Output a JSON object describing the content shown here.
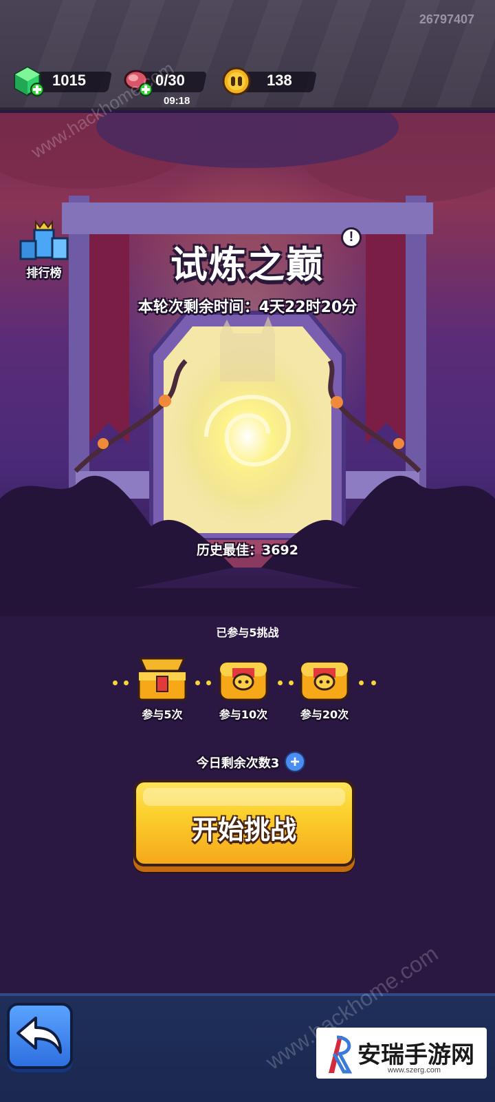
{
  "player_id": "26797407",
  "resources": {
    "gems": {
      "icon": "green-gem-icon",
      "value": "1015"
    },
    "stamina": {
      "icon": "meat-icon",
      "value": "0/30",
      "timer": "09:18"
    },
    "coins": {
      "icon": "coin-icon",
      "value": "138"
    }
  },
  "leaderboard": {
    "label": "排行榜",
    "icon": "crown-trophy-icon"
  },
  "trial": {
    "title": "试炼之巅",
    "info_icon": "!",
    "round_time": "本轮次剩余时间：4天22时20分",
    "best": "历史最佳：3692"
  },
  "progress": {
    "joined_text": "已参与5挑战",
    "chests": [
      {
        "label": "参与5次",
        "state": "opened"
      },
      {
        "label": "参与10次",
        "state": "locked"
      },
      {
        "label": "参与20次",
        "state": "locked"
      }
    ]
  },
  "attempts": {
    "text": "今日剩余次数3",
    "plus_icon": "+"
  },
  "start_button": {
    "label": "开始挑战"
  },
  "watermarks": {
    "hackhome": "www.hackhome.com",
    "site_name": "安瑞手游网",
    "site_url": "www.szerg.com"
  },
  "colors": {
    "accent_yellow": "#fbcf2c",
    "button_border": "#3a2012",
    "bottombar_blue": "#1f2f5a",
    "back_button_blue": "#2f6fe0"
  }
}
